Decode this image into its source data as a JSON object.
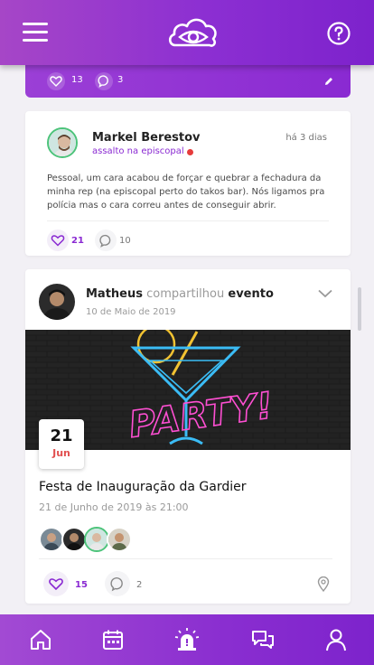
{
  "header": {
    "menu_icon": "hamburger-icon",
    "logo_icon": "cloud-eye-logo",
    "help_icon": "help-circle-icon"
  },
  "top_card": {
    "likes": "13",
    "comments": "3",
    "edit_icon": "pencil-icon"
  },
  "post": {
    "author": "Markel  Berestov",
    "location": "assalto na episcopal",
    "time": "há 3 dias",
    "text": "Pessoal, um cara acabou de forçar e quebrar a fechadura da minha rep (na episcopal perto do takos bar). Nós ligamos pra polícia mas o cara correu antes de conseguir abrir.",
    "likes": "21",
    "comments": "10"
  },
  "event_post": {
    "author": "Matheus",
    "action": "compartilhou",
    "object": "evento",
    "date": "10 de Maio de 2019",
    "banner_text": "PARTY!",
    "day": "21",
    "month": "Jun",
    "title": "Festa de Inauguração da Gardier",
    "when": "21 de Junho de 2019 às 21:00",
    "likes": "15",
    "comments": "2"
  },
  "bottom_nav": [
    "home-icon",
    "calendar-icon",
    "alert-siren-icon",
    "chat-icon",
    "profile-icon"
  ],
  "colors": {
    "primary": "#8c2fd2",
    "accent_red": "#e14f4f",
    "purple_text": "#8a2ad2"
  }
}
